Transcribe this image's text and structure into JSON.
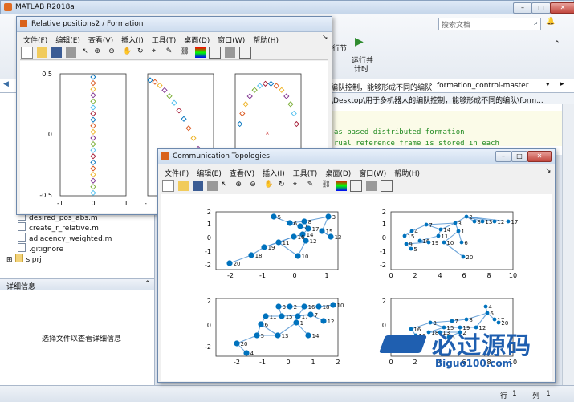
{
  "app": {
    "title": "MATLAB R2018a",
    "search_placeholder": "搜索文档"
  },
  "ribbon": {
    "btn1": "行节",
    "btn2_line1": "运行并",
    "btn2_line2": "计时"
  },
  "address": {
    "crumb1": "编队控制，能够形成不同的编队",
    "crumb2": "formation_control-master",
    "path": "\\Desktop\\用于多机器人的编队控制，能够形成不同的编队\\form..."
  },
  "editor": {
    "line1": "as based distributed formation",
    "line2": "rual reference frame is stored in each"
  },
  "files": [
    "desired_pos_abs.m",
    "create_r_relative.m",
    "adjacency_weighted.m",
    ".gitignore",
    "slprj"
  ],
  "details": {
    "header": "详细信息",
    "empty_msg": "选择文件以查看详细信息"
  },
  "status": {
    "row_label": "行",
    "row_value": "1",
    "col_label": "列",
    "col_value": "1"
  },
  "watermark": {
    "brand": "必过源码",
    "url": "Biguo100.com"
  },
  "fig1": {
    "title": "Relative positions2 / Formation",
    "menu": [
      "文件(F)",
      "编辑(E)",
      "查看(V)",
      "插入(I)",
      "工具(T)",
      "桌面(D)",
      "窗口(W)",
      "帮助(H)"
    ],
    "yticks": [
      "0.5",
      "0",
      "-0.5"
    ],
    "xticks_a": [
      "-1",
      "0",
      "1"
    ],
    "xticks_b": [
      "-1"
    ]
  },
  "fig2": {
    "title": "Communication Topologies",
    "menu": [
      "文件(F)",
      "编辑(E)",
      "查看(V)",
      "插入(I)",
      "工具(T)",
      "桌面(D)",
      "窗口(W)",
      "帮助(H)"
    ],
    "tl": {
      "yticks": [
        "2",
        "1",
        "0",
        "-1",
        "-2"
      ],
      "xticks": [
        "-2",
        "-1",
        "0",
        "1"
      ]
    },
    "tr": {
      "yticks": [
        "2",
        "1",
        "0",
        "-1",
        "-2"
      ],
      "xticks": [
        "0",
        "2",
        "4",
        "6",
        "8",
        "10"
      ]
    },
    "bl": {
      "yticks": [
        "2",
        "0",
        "-2"
      ],
      "xticks": [
        "-2",
        "-1",
        "0",
        "1",
        "2"
      ]
    },
    "br": {
      "yticks": [
        "2",
        "0",
        "-2"
      ],
      "xticks": [
        "0",
        "2",
        "4",
        "6",
        "8",
        "10"
      ]
    }
  },
  "colors": {
    "accent": "#0072bd",
    "titlebar": "#cddcee"
  }
}
